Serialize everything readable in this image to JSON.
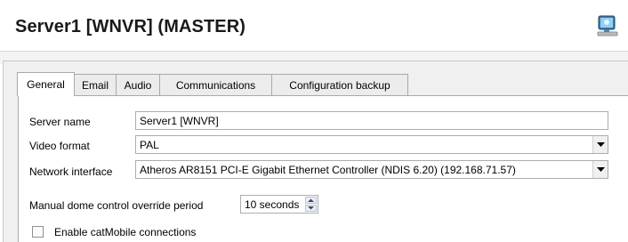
{
  "header": {
    "title": "Server1 [WNVR] (MASTER)"
  },
  "tabs": [
    {
      "label": "General",
      "active": true
    },
    {
      "label": "Email",
      "active": false
    },
    {
      "label": "Audio",
      "active": false
    },
    {
      "label": "Communications",
      "active": false
    },
    {
      "label": "Configuration backup",
      "active": false
    }
  ],
  "form": {
    "server_name_label": "Server name",
    "server_name_value": "Server1 [WNVR]",
    "video_format_label": "Video format",
    "video_format_value": "PAL",
    "network_interface_label": "Network interface",
    "network_interface_value": "Atheros AR8151 PCI-E Gigabit Ethernet Controller (NDIS 6.20) (192.168.71.57)",
    "dome_override_label": "Manual dome control override period",
    "dome_override_value": "10 seconds",
    "catmobile_label": "Enable catMobile connections",
    "catmobile_checked": false
  },
  "icons": {
    "header_icon": "server-computer-icon"
  }
}
